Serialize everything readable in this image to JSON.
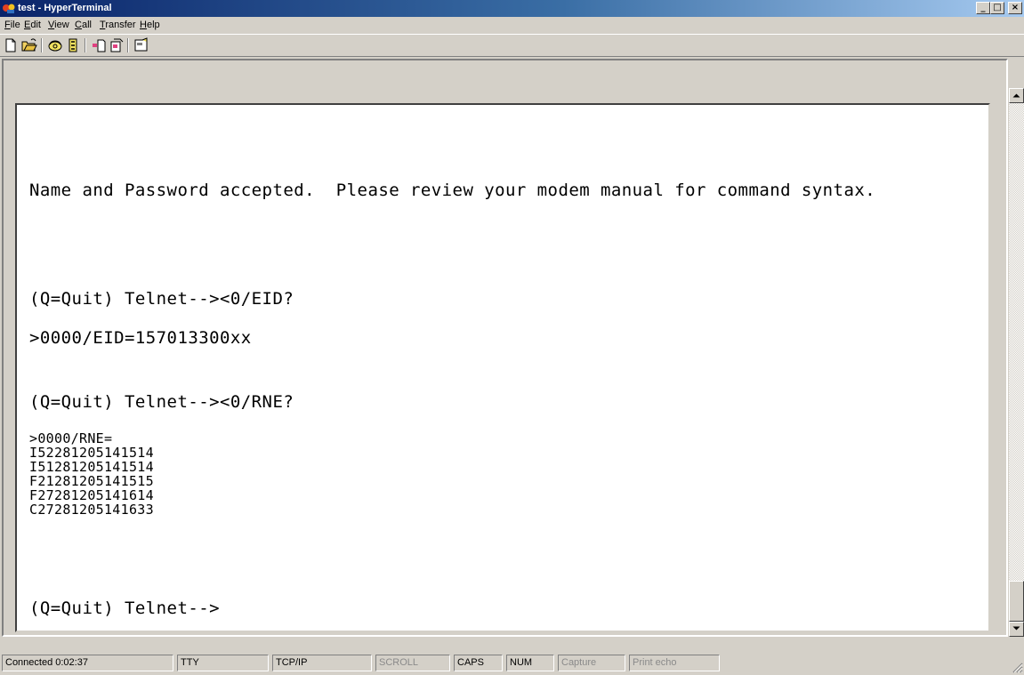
{
  "window": {
    "title": "test - HyperTerminal",
    "minimize_glyph": "_",
    "maximize_glyph": "□",
    "close_glyph": "×"
  },
  "menu": [
    {
      "accel": "F",
      "rest": "ile"
    },
    {
      "accel": "E",
      "rest": "dit"
    },
    {
      "accel": "V",
      "rest": "iew"
    },
    {
      "accel": "C",
      "rest": "all"
    },
    {
      "accel": "T",
      "rest": "ransfer"
    },
    {
      "accel": "H",
      "rest": "elp"
    }
  ],
  "toolbar": {
    "buttons": [
      "new-document-icon",
      "open-folder-icon",
      "call-icon",
      "disconnect-icon",
      "send-file-icon",
      "receive-file-icon",
      "properties-icon"
    ]
  },
  "terminal": {
    "lines": [
      "Name and Password accepted.  Please review your modem manual for command syntax.",
      "(Q=Quit) Telnet--><0/EID?",
      ">0000/EID=157013300xx",
      "(Q=Quit) Telnet--><0/RNE?",
      ">0000/RNE=",
      "I52281205141514",
      "I51281205141514",
      "F21281205141515",
      "F27281205141614",
      "C27281205141633",
      "(Q=Quit) Telnet-->"
    ]
  },
  "status": {
    "connection": "Connected 0:02:37",
    "emulation": "TTY",
    "protocol": "TCP/IP",
    "scroll": "SCROLL",
    "caps": "CAPS",
    "num": "NUM",
    "capture": "Capture",
    "print_echo": "Print echo"
  },
  "colors": {
    "title_gradient_start": "#0a246a",
    "title_gradient_end": "#a6caf0",
    "chrome": "#d4d0c8",
    "terminal_bg": "#ffffff"
  }
}
